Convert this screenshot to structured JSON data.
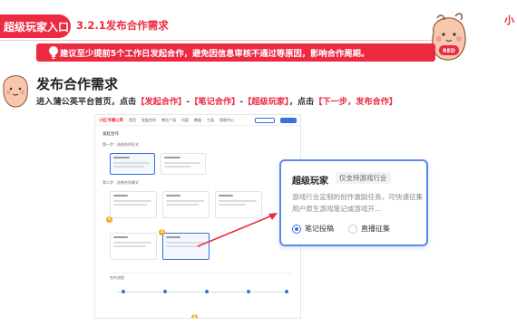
{
  "header": {
    "tag_label": "超级玩家入口",
    "title": "3.2.1发布合作需求",
    "brand_mark": "小"
  },
  "banner": {
    "tip": "建议至少提前5个工作日发起合作，避免因信息审核不通过等原因，影响合作周期。"
  },
  "mascot": {
    "badge": "RED"
  },
  "section": {
    "title": "发布合作需求",
    "desc_prefix": "进入蒲公英平台首页，点击",
    "step1": "【发起合作】",
    "sep1": "-",
    "step2": "【笔记合作】",
    "sep2": "-",
    "step3": "【超级玩家】",
    "mid": "，点击",
    "step4": "【下一步，发布合作】"
  },
  "screenshot": {
    "logo": "小红书蒲公英",
    "nav": [
      "首页",
      "发起合作",
      "博主广场",
      "内容",
      "数据",
      "工具",
      "帮助中心"
    ],
    "breadcrumb": "发起合作",
    "step1_label": "第一步：选择合作形式",
    "step2_label": "第二步：选择合作模式",
    "flow_label": "合作流程",
    "markers": [
      "1",
      "2",
      "3"
    ]
  },
  "popup": {
    "title": "超级玩家",
    "tag": "仅支持游戏行业",
    "desc": "游戏行业定制的创作激励任务，可快速征集用户原生游戏笔记或游戏开...",
    "options": [
      {
        "label": "笔记投稿",
        "selected": true
      },
      {
        "label": "直播征集",
        "selected": false
      }
    ]
  },
  "colors": {
    "accent": "#ec2b42",
    "blue": "#3b6fe0",
    "marker": "#f5a623"
  }
}
